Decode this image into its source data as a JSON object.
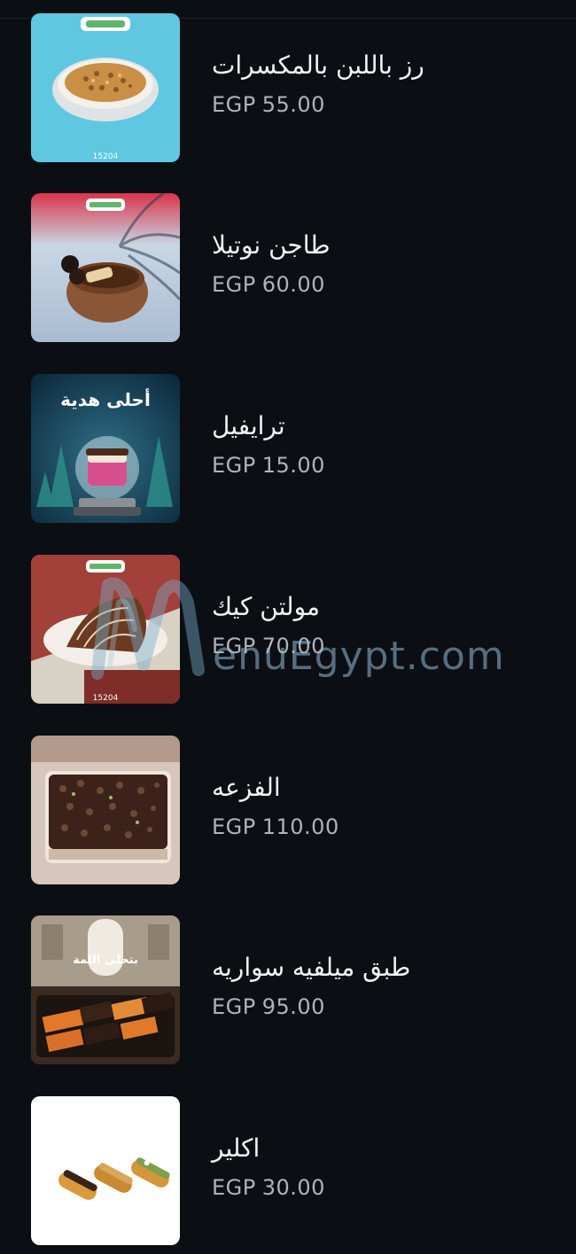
{
  "menu": {
    "items": [
      {
        "name": "رز باللبن بالمكسرات",
        "currency": "EGP",
        "price": "55.00",
        "thumb_code": "15204"
      },
      {
        "name": "طاجن نوتيلا",
        "currency": "EGP",
        "price": "60.00"
      },
      {
        "name": "ترايفيل",
        "currency": "EGP",
        "price": "15.00",
        "thumb_text": "أحلى هدية"
      },
      {
        "name": "مولتن كيك",
        "currency": "EGP",
        "price": "70.00",
        "thumb_code": "15204"
      },
      {
        "name": "الفزعه",
        "currency": "EGP",
        "price": "110.00"
      },
      {
        "name": "طبق ميلفيه سواريه",
        "currency": "EGP",
        "price": "95.00",
        "thumb_text": "بتحلى اللمة"
      },
      {
        "name": "اكلير",
        "currency": "EGP",
        "price": "30.00"
      }
    ]
  },
  "watermark": {
    "text": "enuEgypt.com"
  },
  "colors": {
    "background": "#0b0f14",
    "name_text": "#f1f3f5",
    "price_text": "#aeb4ba"
  }
}
